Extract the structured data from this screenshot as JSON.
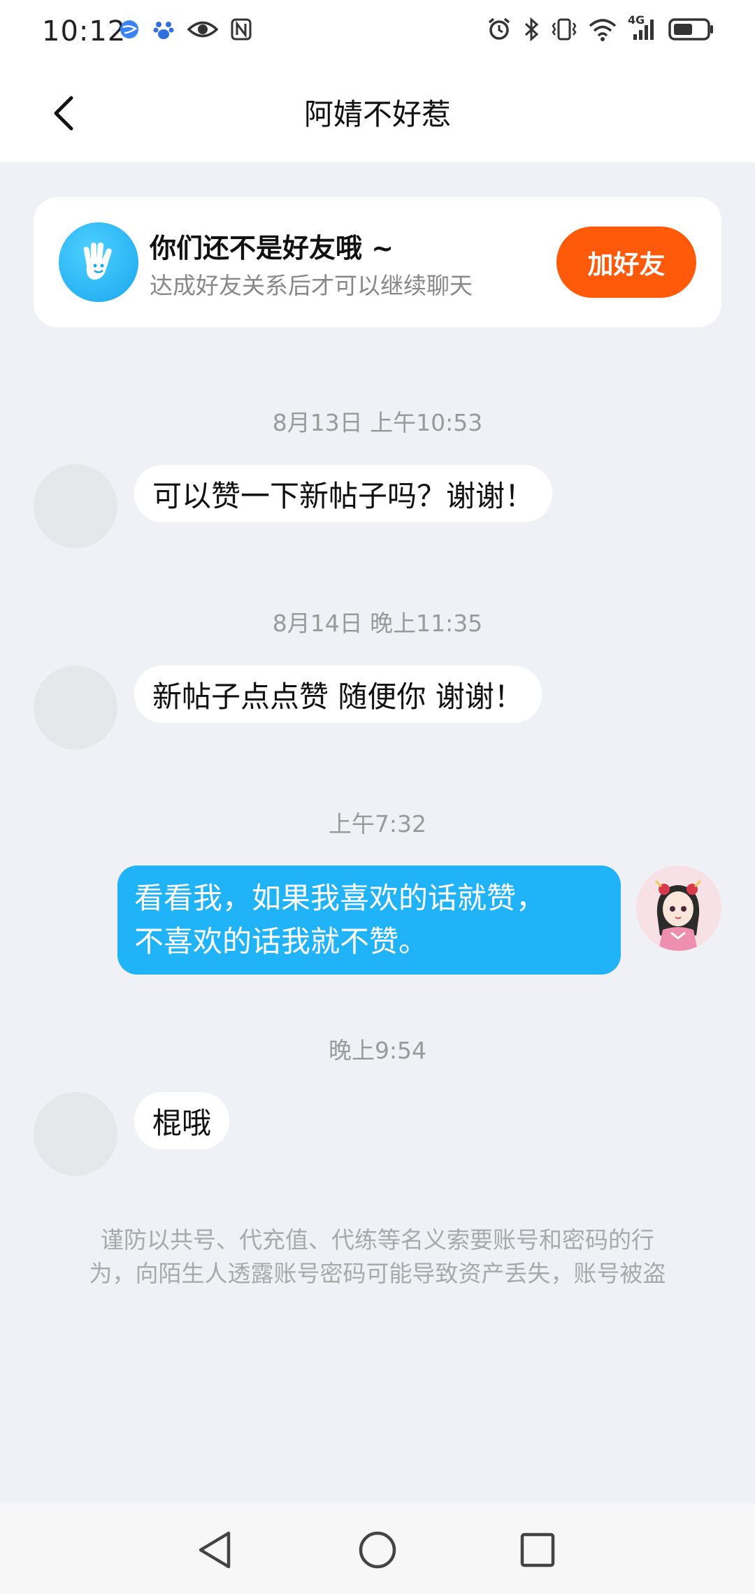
{
  "status_bar": {
    "time": "10:12",
    "network": "4G"
  },
  "header": {
    "title": "阿婧不好惹"
  },
  "friend_banner": {
    "title": "你们还不是好友哦 ~",
    "subtitle": "达成好友关系后才可以继续聊天",
    "button_label": "加好友"
  },
  "messages": [
    {
      "timestamp": "8月13日 上午10:53",
      "direction": "incoming",
      "text": "可以赞一下新帖子吗？谢谢！"
    },
    {
      "timestamp": "8月14日 晚上11:35",
      "direction": "incoming",
      "text": "新帖子点点赞 随便你 谢谢！"
    },
    {
      "timestamp": "上午7:32",
      "direction": "outgoing",
      "line1": "看看我，如果我喜欢的话就赞，",
      "line2": "不喜欢的话我就不赞。"
    },
    {
      "timestamp": "晚上9:54",
      "direction": "incoming",
      "text": "棍哦"
    }
  ],
  "notice": {
    "line1": "谨防以共号、代充值、代练等名义索要账号和密码的行",
    "line2": "为，向陌生人透露账号密码可能导致资产丢失，账号被盗"
  },
  "colors": {
    "accent_blue": "#20b3f7",
    "add_friend_orange": "#ff5a0a",
    "background": "#eff1f6"
  }
}
